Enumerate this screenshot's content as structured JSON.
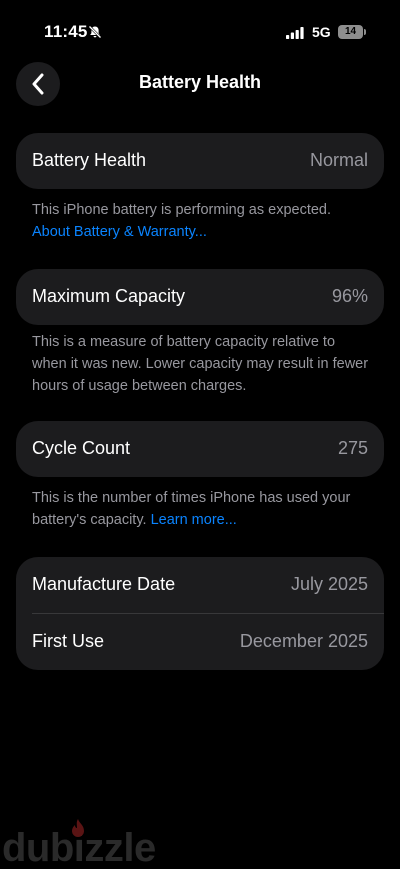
{
  "status_bar": {
    "time": "11:45",
    "network": "5G",
    "battery_level": "14"
  },
  "nav": {
    "back_icon": "chevron-left-icon",
    "title": "Battery Health"
  },
  "health": {
    "label": "Battery Health",
    "value": "Normal",
    "note": "This iPhone battery is performing as expected.",
    "link": "About Battery & Warranty..."
  },
  "capacity": {
    "label": "Maximum Capacity",
    "value": "96%",
    "note": "This is a measure of battery capacity relative to when it was new. Lower capacity may result in fewer hours of usage between charges."
  },
  "cycles": {
    "label": "Cycle Count",
    "value": "275",
    "note": "This is the number of times iPhone has used your battery's capacity.",
    "link": "Learn more..."
  },
  "dates": {
    "manufacture_label": "Manufacture Date",
    "manufacture_value": "July 2025",
    "first_use_label": "First Use",
    "first_use_value": "December 2025"
  },
  "watermark": "dubizzle",
  "colors": {
    "background": "#000000",
    "card": "#1c1c1e",
    "secondary_text": "#98989f",
    "link": "#0a84ff"
  }
}
